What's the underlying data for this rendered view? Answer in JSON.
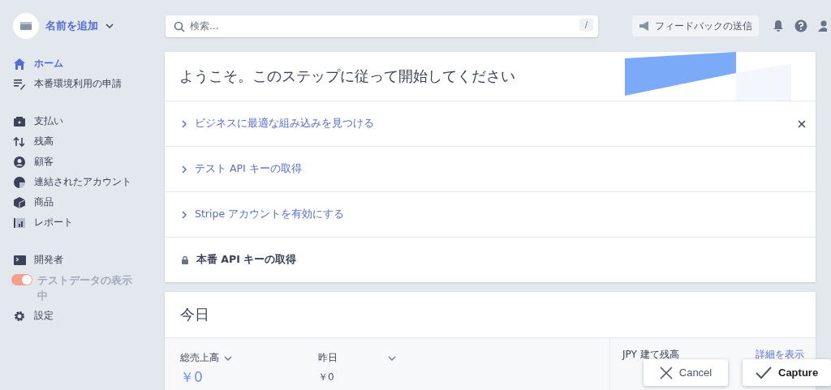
{
  "account": {
    "name": "名前を追加"
  },
  "sidebar": {
    "groups": [
      [
        {
          "kind": "link",
          "label": "ホーム",
          "selected": true
        },
        {
          "kind": "link",
          "label": "本番環境利用の申請",
          "selected": false
        }
      ],
      [
        {
          "kind": "link",
          "label": "支払い",
          "selected": false
        },
        {
          "kind": "link",
          "label": "残高",
          "selected": false
        },
        {
          "kind": "link",
          "label": "顧客",
          "selected": false
        },
        {
          "kind": "link",
          "label": "連結されたアカウント",
          "selected": false
        },
        {
          "kind": "link",
          "label": "商品",
          "selected": false
        },
        {
          "kind": "link",
          "label": "レポート",
          "selected": false
        }
      ],
      [
        {
          "kind": "link",
          "label": "開発者",
          "selected": false
        },
        {
          "kind": "toggle",
          "label": "テストデータの表示中",
          "on": true
        },
        {
          "kind": "link",
          "label": "設定",
          "selected": false
        }
      ]
    ]
  },
  "search": {
    "placeholder": "検索...",
    "shortcut": "/"
  },
  "feedback_button": "フィードバックの送信",
  "steps": {
    "title": "ようこそ。このステップに従って開始してください",
    "items": [
      {
        "kind": "link",
        "label": "ビジネスに最適な組み込みを見つける"
      },
      {
        "kind": "link",
        "label": "テスト API キーの取得"
      },
      {
        "kind": "link",
        "label": "Stripe アカウントを有効にする"
      },
      {
        "kind": "locked",
        "label": "本番 API キーの取得"
      }
    ]
  },
  "today": {
    "title": "今日",
    "metrics": [
      {
        "label": "総売上高",
        "value": "￥0",
        "highlight": true
      },
      {
        "label": "昨日",
        "value": "￥0",
        "highlight": false
      }
    ],
    "balance": {
      "label": "JPY 建て残高",
      "link": "詳細を表示"
    }
  },
  "buttons": [
    {
      "kind": "cancel",
      "label": "Cancel"
    },
    {
      "kind": "capture",
      "label": "Capture"
    }
  ]
}
